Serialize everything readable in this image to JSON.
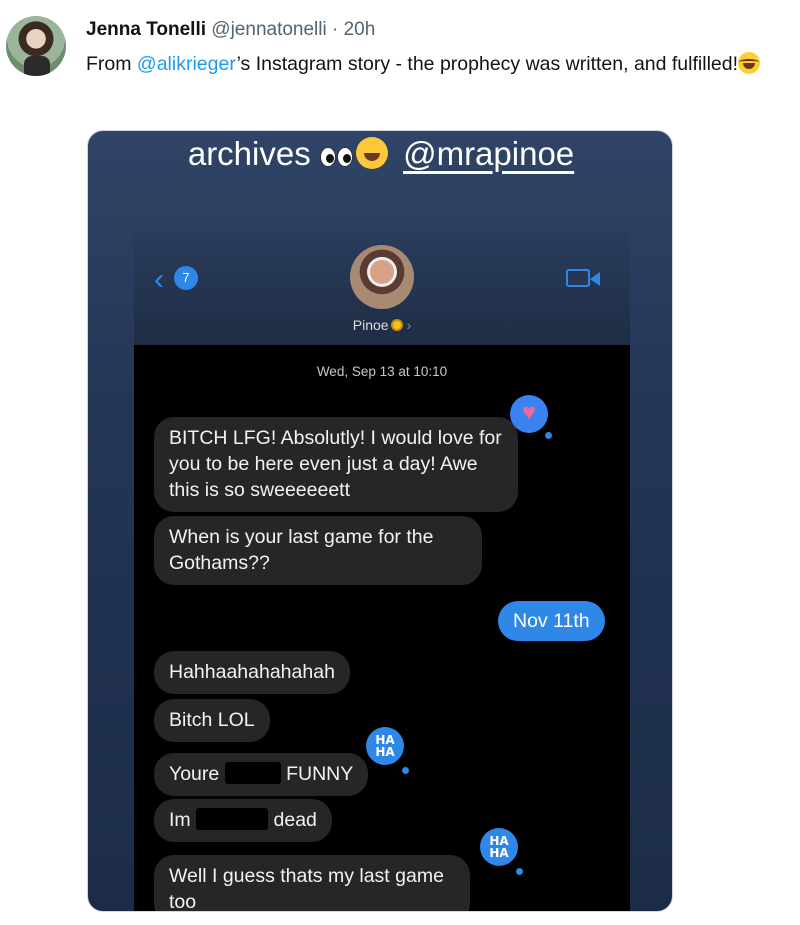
{
  "tweet": {
    "author_name": "Jenna Tonelli",
    "handle": "@jennatonelli",
    "separator": "·",
    "time": "20h",
    "text_prefix": "From ",
    "text_mention": "@alikrieger",
    "text_suffix": "’s Instagram story - the prophecy was written, and fulfilled!",
    "emoji": "face-with-tears-of-joy"
  },
  "story": {
    "caption_word": "archives",
    "caption_emojis": [
      "eyes",
      "face-with-tears-of-joy"
    ],
    "caption_mention": "@mrapinoe"
  },
  "conversation": {
    "unread_count": "7",
    "contact_name": "Pinoe",
    "contact_emoji": "sunflower",
    "timestamp": "Wed, Sep 13 at 10:10",
    "messages": [
      {
        "direction": "incoming",
        "text": "BITCH LFG! Absolutly! I would love for you to be here even just a day! Awe this is so sweeeeeett",
        "tapback": "heart"
      },
      {
        "direction": "incoming",
        "text": "When is your last game for the Gothams??"
      },
      {
        "direction": "outgoing",
        "text": "Nov 11th"
      },
      {
        "direction": "incoming",
        "text": "Hahhaahahahahah"
      },
      {
        "direction": "incoming",
        "text": "Bitch LOL",
        "tapback": "haha"
      },
      {
        "direction": "incoming",
        "text_before": "Youre",
        "text_after": "FUNNY",
        "redacted": true
      },
      {
        "direction": "incoming",
        "text_before": "Im",
        "text_after": "dead",
        "redacted": true,
        "tapback": "haha"
      },
      {
        "direction": "incoming",
        "text": "Well I guess thats my last game too"
      }
    ],
    "haha_label_1": "HA",
    "haha_label_2": "HA"
  }
}
